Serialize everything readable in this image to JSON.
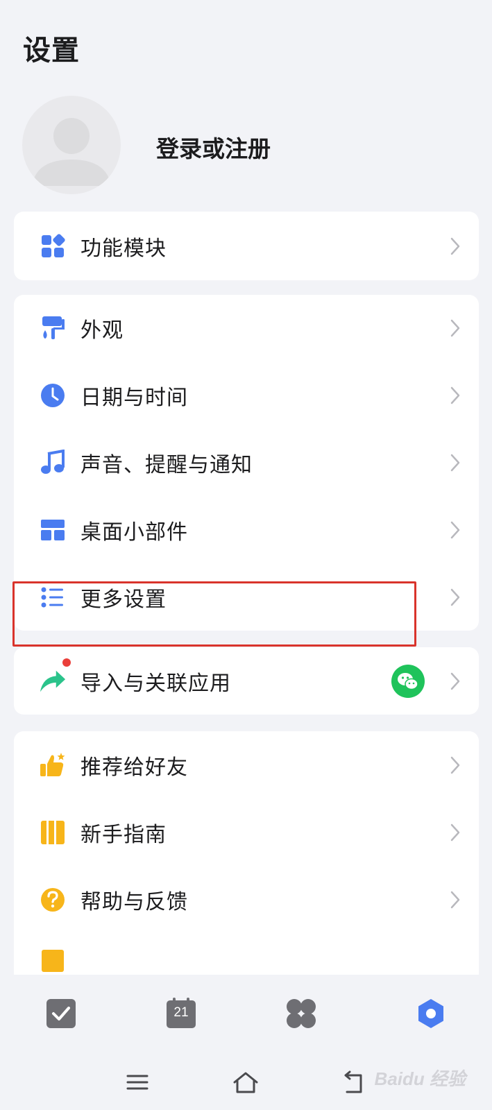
{
  "header": {
    "title": "设置"
  },
  "profile": {
    "login_label": "登录或注册"
  },
  "groups": [
    {
      "items": [
        {
          "label": "功能模块",
          "icon": "widgets-icon"
        }
      ]
    },
    {
      "items": [
        {
          "label": "外观",
          "icon": "paint-roller-icon"
        },
        {
          "label": "日期与时间",
          "icon": "clock-icon"
        },
        {
          "label": "声音、提醒与通知",
          "icon": "music-note-icon"
        },
        {
          "label": "桌面小部件",
          "icon": "desktop-widget-icon"
        },
        {
          "label": "更多设置",
          "icon": "list-icon"
        }
      ]
    },
    {
      "items": [
        {
          "label": "导入与关联应用",
          "icon": "share-arrow-icon"
        }
      ]
    },
    {
      "items": [
        {
          "label": "推荐给好友",
          "icon": "thumbs-up-icon"
        },
        {
          "label": "新手指南",
          "icon": "guide-book-icon"
        },
        {
          "label": "帮助与反馈",
          "icon": "help-icon"
        }
      ]
    }
  ],
  "tabbar": {
    "calendar_day": "21"
  },
  "watermark": "Baidu 经验",
  "colors": {
    "accent_blue": "#4a7cf0",
    "accent_orange": "#f7b51a",
    "accent_green": "#2bc38b",
    "wechat_green": "#1fc35b",
    "highlight_red": "#d9332b",
    "background": "#f2f3f7"
  }
}
